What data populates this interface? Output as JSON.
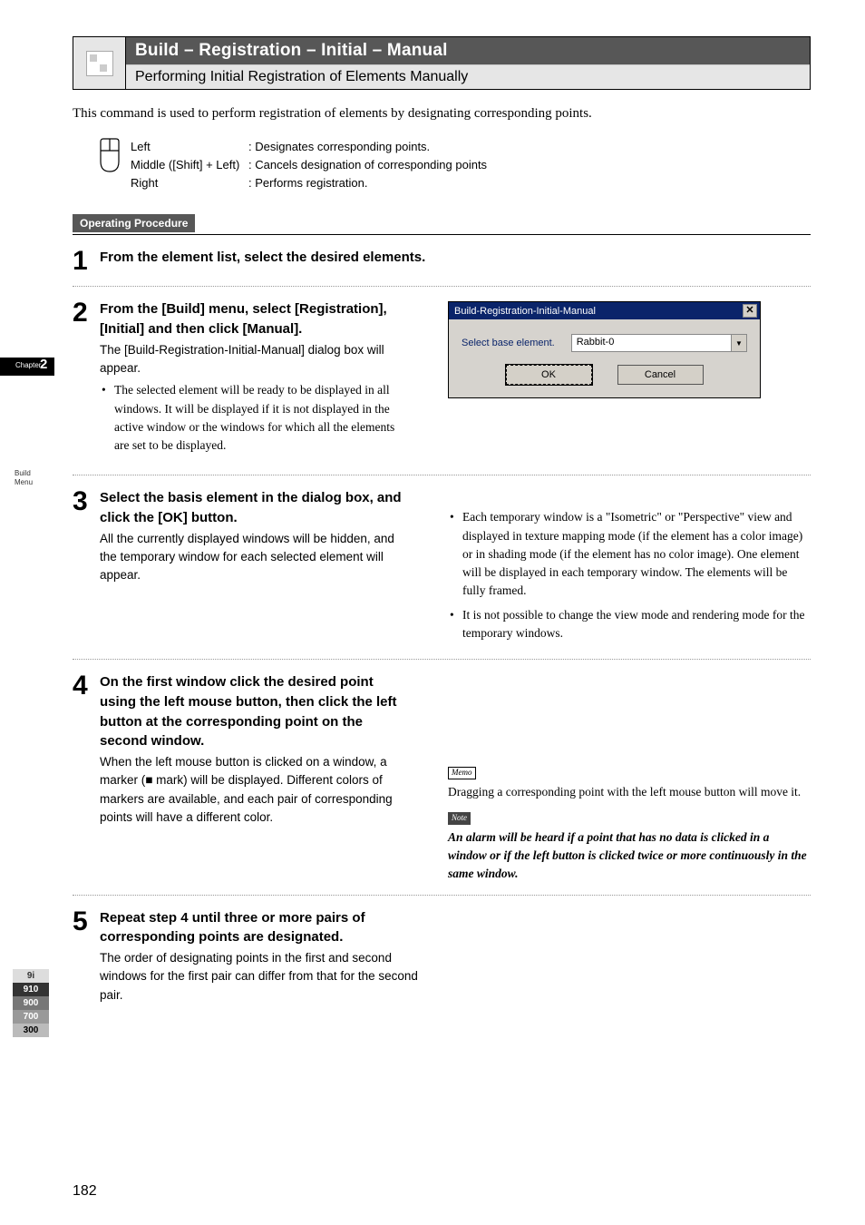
{
  "chapter": {
    "prefix": "Chapter",
    "number": "2"
  },
  "sidebar_labels": {
    "build": "Build",
    "menu": "Menu"
  },
  "series": {
    "i9": "9i",
    "n910": "910",
    "n900": "900",
    "n700": "700",
    "n300": "300"
  },
  "header": {
    "title": "Build – Registration – Initial – Manual",
    "subtitle": "Performing Initial Registration of Elements Manually"
  },
  "intro": "This command is used to perform registration of elements by designating corresponding points.",
  "mouse": {
    "left_label": "Left",
    "left_desc": ": Designates corresponding points.",
    "middle_label": "Middle ([Shift] + Left)",
    "middle_desc": ": Cancels designation of corresponding points",
    "right_label": "Right",
    "right_desc": ": Performs registration."
  },
  "operating_procedure": "Operating Procedure",
  "steps": {
    "s1": {
      "num": "1",
      "title": "From the element list, select the desired elements."
    },
    "s2": {
      "num": "2",
      "title": "From the [Build] menu, select [Registration], [Initial] and then click [Manual].",
      "body": "The [Build-Registration-Initial-Manual] dialog box will appear.",
      "bullet": "The selected element will be ready to be displayed in all windows. It will be displayed if it is not displayed in the active window or the windows for which all the elements are set to be displayed."
    },
    "s3": {
      "num": "3",
      "title": "Select the basis element in the dialog box, and click the [OK] button.",
      "body": "All the currently displayed windows will be hidden, and the temporary window for each selected element will appear.",
      "right_bullet1": "Each temporary window is a \"Isometric\" or \"Perspective\" view and displayed in texture mapping mode (if the element has a color image) or in shading mode (if the element has no color image). One element will be displayed in each temporary window. The elements will be fully framed.",
      "right_bullet2": "It is not possible to change the view mode and rendering mode for the temporary windows."
    },
    "s4": {
      "num": "4",
      "title": "On the first window click the desired point using the left mouse button, then click the left button at the corresponding point on the second window.",
      "body": "When the left mouse button is clicked on a window, a marker (■ mark) will be displayed. Different colors of markers are available, and each pair of corresponding points will have a different color.",
      "memo_tag": "Memo",
      "memo_text": "Dragging a corresponding point with the left mouse button will move it.",
      "note_tag": "Note",
      "note_text": "An alarm will be heard if a point that has no data is clicked in a window or if the left button is clicked twice or more continuously in the same window."
    },
    "s5": {
      "num": "5",
      "title": "Repeat step 4 until three or more pairs of corresponding points are designated.",
      "body": "The order of designating points in the first and second windows for the first pair can differ from that for the second pair."
    }
  },
  "dialog": {
    "title": "Build-Registration-Initial-Manual",
    "close": "✕",
    "label": "Select base element.",
    "value": "Rabbit-0",
    "ok": "OK",
    "cancel": "Cancel"
  },
  "page_number": "182"
}
